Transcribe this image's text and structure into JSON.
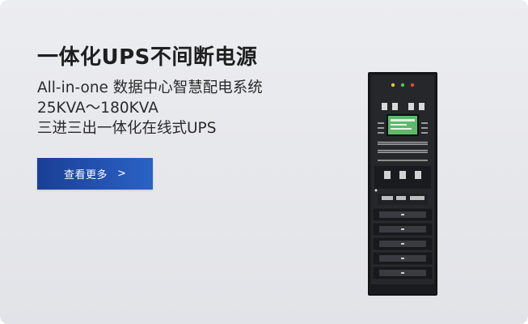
{
  "banner": {
    "title": "一体化UPS不间断电源",
    "lines": [
      "All-in-one 数据中心智慧配电系统",
      "25KVA～180KVA",
      "三进三出一体化在线式UPS"
    ],
    "cta_label": "查看更多",
    "cta_arrow": ">",
    "accent_color": "#2256b3"
  },
  "icons": {
    "cta_arrow_icon": "chevron-right-icon",
    "product_image": "ups-cabinet-image"
  }
}
